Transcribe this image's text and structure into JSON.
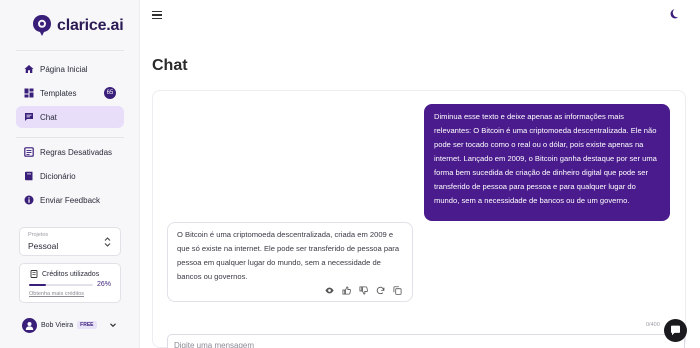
{
  "brand": {
    "name": "clarice.ai"
  },
  "nav": {
    "items": [
      {
        "label": "Página Inicial",
        "icon": "home-icon"
      },
      {
        "label": "Templates",
        "icon": "grid-icon",
        "badge": "65"
      },
      {
        "label": "Chat",
        "icon": "chat-icon",
        "active": true
      },
      {
        "label": "Regras Desativadas",
        "icon": "rules-off-icon"
      },
      {
        "label": "Dicionário",
        "icon": "book-icon"
      },
      {
        "label": "Enviar Feedback",
        "icon": "info-icon"
      }
    ]
  },
  "project": {
    "label": "Projetos",
    "value": "Pessoal"
  },
  "credits": {
    "title": "Créditos utilizados",
    "percent_label": "26%",
    "fraction": 0.26,
    "link": "Obtenha mais créditos"
  },
  "user": {
    "name": "Bob Vieira",
    "plan": "FREE"
  },
  "page": {
    "title": "Chat"
  },
  "messages": {
    "user": "Diminua esse texto e deixe apenas as informações mais relevantes: O Bitcoin é uma criptomoeda descentralizada. Ele não pode ser tocado como o real ou o dólar, pois existe apenas na internet. Lançado em 2009, o Bitcoin ganha destaque por ser uma forma bem sucedida de criação de dinheiro digital que pode ser transferido de pessoa para pessoa e para qualquer lugar do mundo, sem a necessidade de bancos ou de um governo.",
    "assistant": "O Bitcoin é uma criptomoeda descentralizada, criada em 2009 e que só existe na internet. Ele pode ser transferido de pessoa para pessoa em qualquer lugar do mundo, sem a necessidade de bancos ou governos."
  },
  "composer": {
    "placeholder": "Digite uma mensagem",
    "counter": "0/400"
  },
  "colors": {
    "accent": "#4a1b8c",
    "active_bg": "#e8defa",
    "sidebar_bg": "#f7f7f9"
  }
}
